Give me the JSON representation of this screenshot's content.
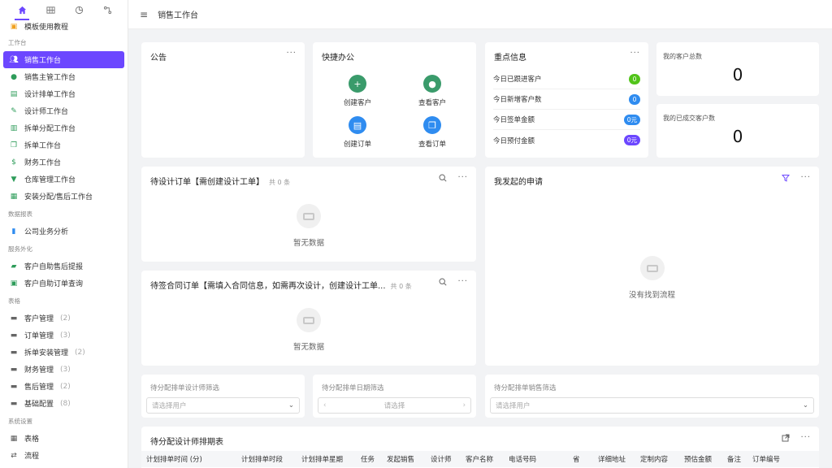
{
  "header": {
    "title": "销售工作台"
  },
  "sidebar": {
    "tutorial": "模板使用教程",
    "group_workbench": "工作台",
    "workbench_items": [
      {
        "label": "销售工作台"
      },
      {
        "label": "销售主管工作台"
      },
      {
        "label": "设计排单工作台"
      },
      {
        "label": "设计师工作台"
      },
      {
        "label": "拆单分配工作台"
      },
      {
        "label": "拆单工作台"
      },
      {
        "label": "财务工作台"
      },
      {
        "label": "仓库管理工作台"
      },
      {
        "label": "安装分配/售后工作台"
      }
    ],
    "group_reports": "数据报表",
    "report_items": [
      {
        "label": "公司业务分析"
      }
    ],
    "group_service": "服务外化",
    "service_items": [
      {
        "label": "客户自助售后提报"
      },
      {
        "label": "客户自助订单查询"
      }
    ],
    "group_forms": "表格",
    "form_items": [
      {
        "label": "客户管理",
        "count": "(2)"
      },
      {
        "label": "订单管理",
        "count": "(3)"
      },
      {
        "label": "拆单安装管理",
        "count": "(2)"
      },
      {
        "label": "财务管理",
        "count": "(3)"
      },
      {
        "label": "售后管理",
        "count": "(2)"
      },
      {
        "label": "基础配置",
        "count": "(8)"
      }
    ],
    "group_system": "系统设置",
    "system_items": [
      {
        "label": "表格"
      },
      {
        "label": "流程"
      }
    ]
  },
  "announcement": {
    "title": "公告"
  },
  "quick": {
    "title": "快捷办公",
    "items": [
      {
        "label": "创建客户"
      },
      {
        "label": "查看客户"
      },
      {
        "label": "创建订单"
      },
      {
        "label": "查看订单"
      }
    ]
  },
  "key_info": {
    "title": "重点信息",
    "rows": [
      {
        "label": "今日已跟进客户",
        "value": "0"
      },
      {
        "label": "今日新增客户数",
        "value": "0"
      },
      {
        "label": "今日签单金额",
        "value": "0元"
      },
      {
        "label": "今日预付金额",
        "value": "0元"
      }
    ]
  },
  "stats": {
    "total_customers_label": "我的客户总数",
    "total_customers_value": "0",
    "deal_customers_label": "我的已成交客户数",
    "deal_customers_value": "0"
  },
  "pending_design": {
    "title": "待设计订单【需创建设计工单】",
    "count": "共 0 条",
    "empty": "暂无数据"
  },
  "pending_contract": {
    "title": "待签合同订单【需填入合同信息，如需再次设计，创建设计工单...",
    "count": "共 0 条",
    "empty": "暂无数据"
  },
  "my_requests": {
    "title": "我发起的申请",
    "empty": "没有找到流程"
  },
  "filters": {
    "designer": {
      "label": "待分配排单设计师筛选",
      "placeholder": "请选择用户"
    },
    "date": {
      "label": "待分配排单日期筛选",
      "placeholder": "请选择"
    },
    "sales": {
      "label": "待分配排单销售筛选",
      "placeholder": "请选择用户"
    }
  },
  "schedule": {
    "title": "待分配设计师排期表",
    "columns": [
      "计划排单时间 (分)",
      "计划排单时段",
      "计划排单星期",
      "任务",
      "发起销售",
      "设计师",
      "客户名称",
      "电话号码",
      "省",
      "详细地址",
      "定制内容",
      "预估金额",
      "备注",
      "订单编号"
    ]
  },
  "colors": {
    "accent": "#6c47ff",
    "green": "#52c41a",
    "blue": "#2f8cf0",
    "purple": "#6c47ff",
    "icon_green": "#3a9b6b",
    "icon_blue": "#2f8cf0"
  }
}
